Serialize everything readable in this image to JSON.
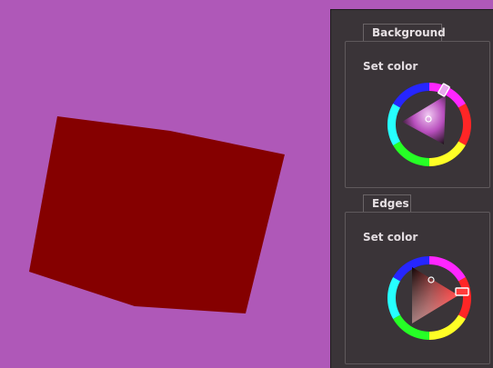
{
  "viewport": {
    "background_color": "#af58b8",
    "shape_color": "#850000"
  },
  "panels": [
    {
      "tab_label": "Background",
      "set_color_label": "Set color",
      "selected_hue_color": "#e040e8",
      "triangle_color": "#d566d8"
    },
    {
      "tab_label": "Edges",
      "set_color_label": "Set color",
      "selected_hue_color": "#ff2020",
      "triangle_color": "#c01818"
    }
  ],
  "icons": {
    "color_wheel": "hue-ring-with-triangle",
    "hue_handle": "square-marker",
    "sv_handle": "circle-marker"
  }
}
